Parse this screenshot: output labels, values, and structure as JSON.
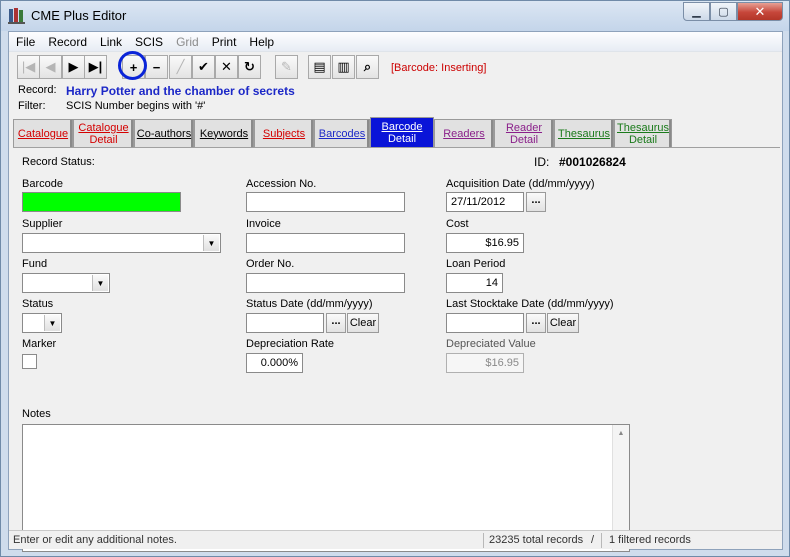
{
  "window": {
    "title": "CME Plus Editor"
  },
  "menu": [
    "File",
    "Record",
    "Link",
    "SCIS",
    "Grid",
    "Print",
    "Help"
  ],
  "toolbar": {
    "mode": "[Barcode: Inserting]",
    "buttons": [
      {
        "name": "first-record-button",
        "icon": "first-icon",
        "glyph": "|◀",
        "enabled": false
      },
      {
        "name": "prev-record-button",
        "icon": "prev-icon",
        "glyph": "◀",
        "enabled": false
      },
      {
        "name": "next-record-button",
        "icon": "next-icon",
        "glyph": "▶",
        "enabled": true
      },
      {
        "name": "last-record-button",
        "icon": "last-icon",
        "glyph": "▶|",
        "enabled": true
      },
      {
        "name": "insert-record-button",
        "icon": "plus-icon",
        "glyph": "+",
        "enabled": true
      },
      {
        "name": "delete-record-button",
        "icon": "minus-icon",
        "glyph": "−",
        "enabled": true
      },
      {
        "name": "edit-record-button",
        "icon": "edit-icon",
        "glyph": "╱",
        "enabled": false
      },
      {
        "name": "post-button",
        "icon": "check-icon",
        "glyph": "✔",
        "enabled": true
      },
      {
        "name": "cancel-button",
        "icon": "cross-icon",
        "glyph": "✕",
        "enabled": true
      },
      {
        "name": "refresh-button",
        "icon": "refresh-icon",
        "glyph": "↻",
        "enabled": true
      },
      {
        "name": "spell-button",
        "icon": "pencil-icon",
        "glyph": "✎",
        "enabled": false
      },
      {
        "name": "print-button",
        "icon": "printer-icon",
        "glyph": "▤",
        "enabled": true
      },
      {
        "name": "print-setup-button",
        "icon": "print-preview-icon",
        "glyph": "▥",
        "enabled": true
      },
      {
        "name": "preview-button",
        "icon": "magnifier-icon",
        "glyph": "⌕",
        "enabled": true
      }
    ]
  },
  "record": {
    "label": "Record:",
    "title": "Harry Potter and the chamber of secrets"
  },
  "filter": {
    "label": "Filter:",
    "value": "SCIS Number begins with '#'"
  },
  "tabs": [
    {
      "top": "Catalogue",
      "bottom": "",
      "color": "red"
    },
    {
      "top": "Catalogue",
      "bottom": "Detail",
      "color": "red"
    },
    {
      "top": "Co-authors",
      "bottom": "",
      "color": "black"
    },
    {
      "top": "Keywords",
      "bottom": "",
      "color": "black"
    },
    {
      "top": "Subjects",
      "bottom": "",
      "color": "red"
    },
    {
      "top": "Barcodes",
      "bottom": "",
      "color": "blue"
    },
    {
      "top": "Barcode",
      "bottom": "Detail",
      "color": "white"
    },
    {
      "top": "Readers",
      "bottom": "",
      "color": "purple"
    },
    {
      "top": "Reader",
      "bottom": "Detail",
      "color": "purple"
    },
    {
      "top": "Thesaurus",
      "bottom": "",
      "color": "green"
    },
    {
      "top": "Thesaurus",
      "bottom": "Detail",
      "color": "green"
    }
  ],
  "detail": {
    "record_status_label": "Record Status:",
    "id_label": "ID:",
    "id_value": "#001026824",
    "barcode_label": "Barcode",
    "barcode_value": "",
    "accession_label": "Accession No.",
    "accession_value": "",
    "acq_date_label": "Acquisition Date (dd/mm/yyyy)",
    "acq_date_value": "27/11/2012",
    "supplier_label": "Supplier",
    "supplier_value": "",
    "invoice_label": "Invoice",
    "invoice_value": "",
    "cost_label": "Cost",
    "cost_value": "$16.95",
    "fund_label": "Fund",
    "fund_value": "",
    "order_label": "Order No.",
    "order_value": "",
    "loan_label": "Loan Period",
    "loan_value": "14",
    "status_label": "Status",
    "status_value": "",
    "status_date_label": "Status Date (dd/mm/yyyy)",
    "status_date_value": "",
    "stocktake_label": "Last Stocktake Date (dd/mm/yyyy)",
    "stocktake_value": "",
    "marker_label": "Marker",
    "depr_rate_label": "Depreciation Rate",
    "depr_rate_value": "0.000%",
    "depr_value_label": "Depreciated Value",
    "depr_value_value": "$16.95",
    "notes_label": "Notes",
    "notes_value": "",
    "dots": "...",
    "clear": "Clear"
  },
  "status": {
    "hint": "Enter or edit any additional notes.",
    "total": "23235 total records",
    "slash": "/",
    "filtered": "1 filtered records"
  },
  "colors": {
    "active_tab": "#0a14d8",
    "barcode_field": "#00ff00",
    "record_title": "#1c28c7",
    "mode_text": "#cc0000"
  }
}
